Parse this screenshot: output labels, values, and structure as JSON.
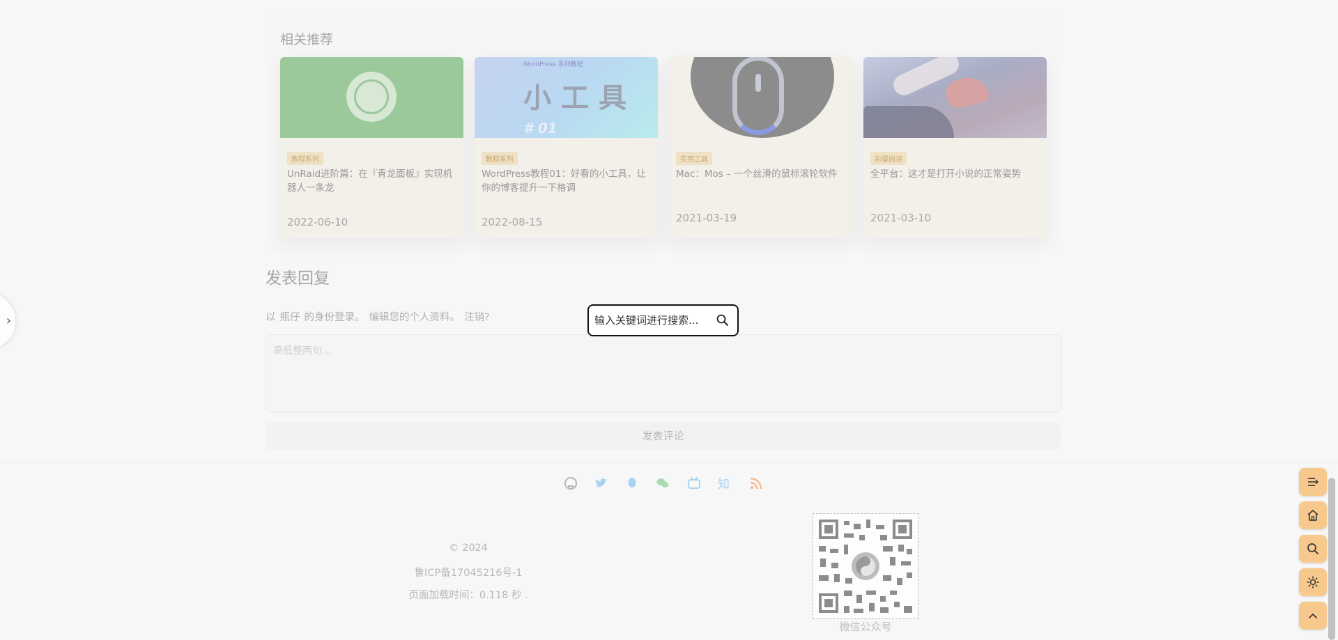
{
  "related": {
    "title": "相关推荐",
    "cards": [
      {
        "tag": "教程系列",
        "title": "UnRaid进阶篇：在『青龙面板』实现机器人一条龙",
        "date": "2022-06-10"
      },
      {
        "tag": "教程系列",
        "title": "WordPress教程01：好看的小工具，让你的博客提升一下格调",
        "date": "2022-08-15",
        "thumb_small": "WordPress 系列教程",
        "thumb_big": "小工具",
        "thumb_num": "# 01"
      },
      {
        "tag": "实用工具",
        "title": "Mac：Mos – 一个丝滑的鼠标滚轮软件",
        "date": "2021-03-19"
      },
      {
        "tag": "彩蛋阅读",
        "title": "全平台：这才是打开小说的正常姿势",
        "date": "2021-03-10"
      }
    ]
  },
  "reply": {
    "title": "发表回复",
    "login_prefix": "以",
    "username": "瓶仔",
    "login_mid": "的身份登录。",
    "edit_profile": "编辑您的个人资料。",
    "logout": "注销?",
    "comment_placeholder": "高低整两句...",
    "submit_label": "发表评论"
  },
  "search": {
    "placeholder": "输入关键词进行搜索..."
  },
  "footer": {
    "social_icons": [
      "github-icon",
      "twitter-icon",
      "qq-icon",
      "wechat-icon",
      "bilibili-icon",
      "zhihu-icon",
      "rss-icon"
    ],
    "copyright": "© 2024",
    "icp": "鲁ICP备17045216号-1",
    "load_time": "页面加载时间：0.118 秒 .",
    "qr_label": "微信公众号"
  },
  "floating_buttons": [
    "toc-icon",
    "home-icon",
    "search-icon",
    "theme-icon",
    "back-to-top-icon"
  ],
  "colors": {
    "accent": "#f8c98c",
    "page_bg": "#f7f7f7"
  }
}
